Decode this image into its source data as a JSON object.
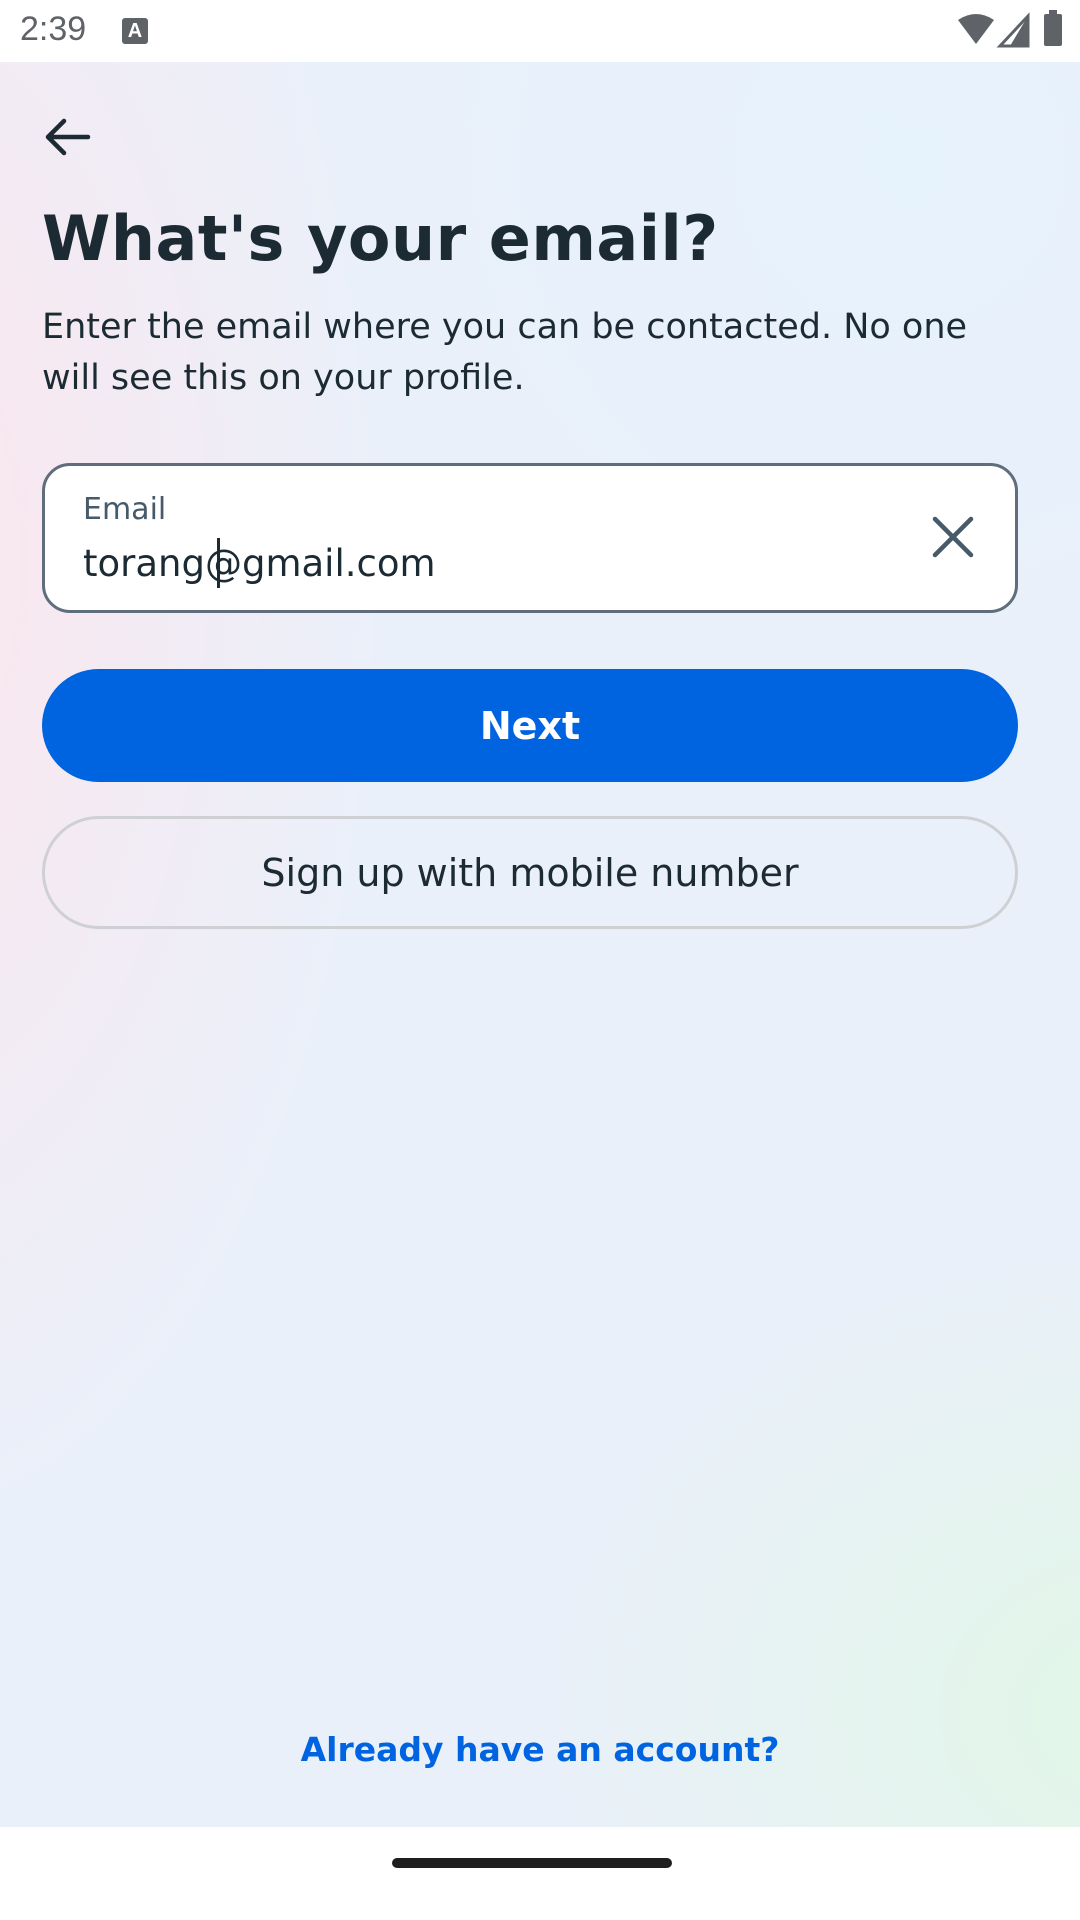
{
  "status_bar": {
    "time": "2:39",
    "notification_icon": "A",
    "icons": [
      "wifi-icon",
      "signal-icon",
      "battery-icon"
    ]
  },
  "header": {
    "back_icon": "arrow-left-icon"
  },
  "page": {
    "title": "What's your email?",
    "subtitle": "Enter the email where you can be contacted. No one will see this on your profile."
  },
  "email_field": {
    "label": "Email",
    "value": "torang@gmail.com",
    "clear_icon": "close-icon"
  },
  "buttons": {
    "next_label": "Next",
    "mobile_label": "Sign up with mobile number"
  },
  "footer": {
    "login_link": "Already have an account?"
  },
  "colors": {
    "primary": "#0064e0",
    "text": "#1c2b33",
    "border": "#5f6d7c"
  }
}
